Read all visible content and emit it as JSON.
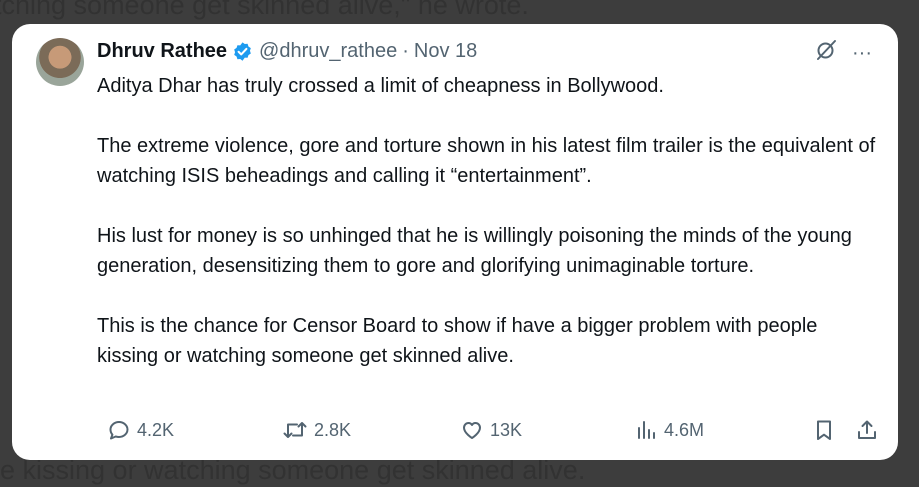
{
  "background": {
    "top_text": "tching someone get skinned alive,\" he wrote.",
    "bottom_text": "le kissing or watching someone get skinned alive."
  },
  "tweet": {
    "author_name": "Dhruv Rathee",
    "handle": "@dhruv_rathee",
    "separator": "·",
    "date": "Nov 18",
    "paragraphs": [
      "Aditya Dhar has truly crossed a limit of cheapness in Bollywood.",
      "The extreme violence, gore and torture  shown in his latest film trailer is the equivalent of watching ISIS beheadings and calling it “entertainment”.",
      "His lust for money is so unhinged that he is willingly poisoning the minds of the young generation, desensitizing them to gore and glorifying unimaginable torture.",
      "This is the chance for Censor Board to show if have a bigger problem with people kissing or watching someone get skinned alive."
    ],
    "more_glyph": "···",
    "stats": {
      "replies": "4.2K",
      "reposts": "2.8K",
      "likes": "13K",
      "views": "4.6M"
    }
  },
  "icons": {
    "verified": "verified-badge-icon",
    "grok": "grok-icon",
    "more": "more-icon",
    "reply": "reply-icon",
    "repost": "repost-icon",
    "like": "heart-icon",
    "views": "views-chart-icon",
    "bookmark": "bookmark-icon",
    "share": "share-icon"
  },
  "colors": {
    "verified_blue": "#1d9bf0",
    "text_primary": "#0f1419",
    "text_secondary": "#536471"
  }
}
